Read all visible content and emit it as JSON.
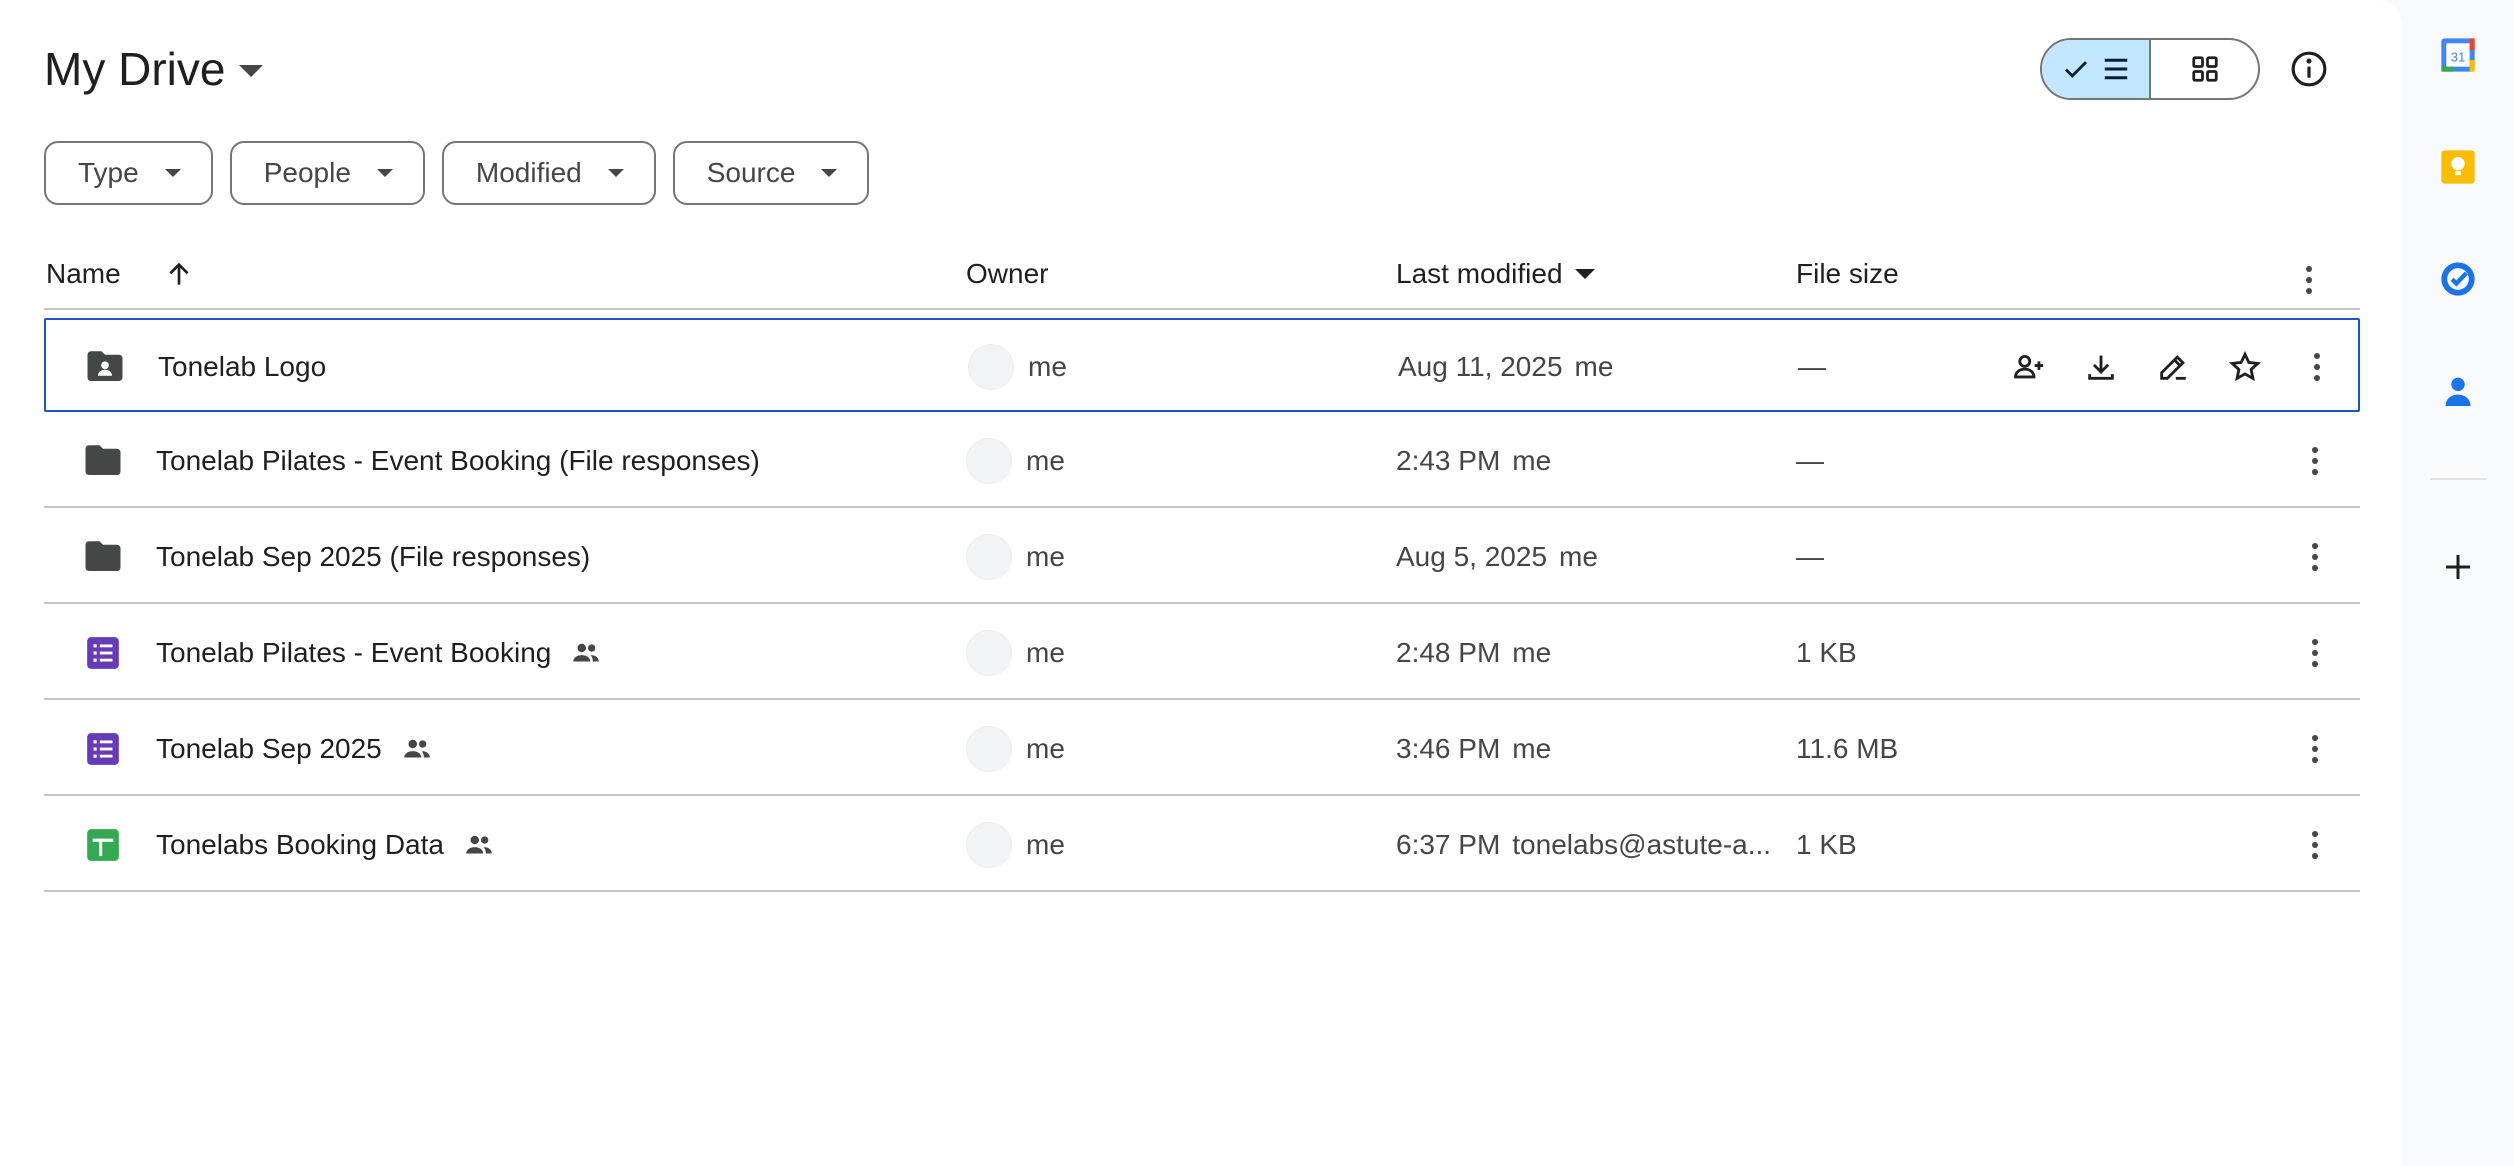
{
  "header": {
    "title": "My Drive"
  },
  "view_toggle": {
    "list_active": true
  },
  "filters": [
    {
      "label": "Type"
    },
    {
      "label": "People"
    },
    {
      "label": "Modified"
    },
    {
      "label": "Source"
    }
  ],
  "columns": {
    "name": "Name",
    "owner": "Owner",
    "last_modified": "Last modified",
    "file_size": "File size"
  },
  "files": [
    {
      "name": "Tonelab Logo",
      "type": "shared-folder",
      "shared": false,
      "owner": "me",
      "date": "Aug 11, 2025",
      "by": "me",
      "size": "—",
      "selected": true
    },
    {
      "name": "Tonelab Pilates - Event Booking (File responses)",
      "type": "folder",
      "shared": false,
      "owner": "me",
      "date": "2:43 PM",
      "by": "me",
      "size": "—",
      "selected": false
    },
    {
      "name": "Tonelab Sep 2025 (File responses)",
      "type": "folder",
      "shared": false,
      "owner": "me",
      "date": "Aug 5, 2025",
      "by": "me",
      "size": "—",
      "selected": false
    },
    {
      "name": "Tonelab Pilates - Event Booking",
      "type": "form",
      "shared": true,
      "owner": "me",
      "date": "2:48 PM",
      "by": "me",
      "size": "1 KB",
      "selected": false
    },
    {
      "name": "Tonelab Sep 2025",
      "type": "form",
      "shared": true,
      "owner": "me",
      "date": "3:46 PM",
      "by": "me",
      "size": "11.6 MB",
      "selected": false
    },
    {
      "name": "Tonelabs Booking Data",
      "type": "sheet",
      "shared": true,
      "owner": "me",
      "date": "6:37 PM",
      "by": "tonelabs@astute-a...",
      "size": "1 KB",
      "selected": false
    }
  ],
  "colors": {
    "form": "#673ab7",
    "sheet": "#34a853",
    "folder": "#444746",
    "selection": "#1a56c6",
    "toggle_active": "#c2e7ff"
  },
  "side_apps": [
    {
      "icon": "calendar-icon",
      "label": "31"
    },
    {
      "icon": "keep-icon"
    },
    {
      "icon": "tasks-icon"
    },
    {
      "icon": "contacts-icon"
    },
    {
      "icon": "add-icon"
    }
  ]
}
